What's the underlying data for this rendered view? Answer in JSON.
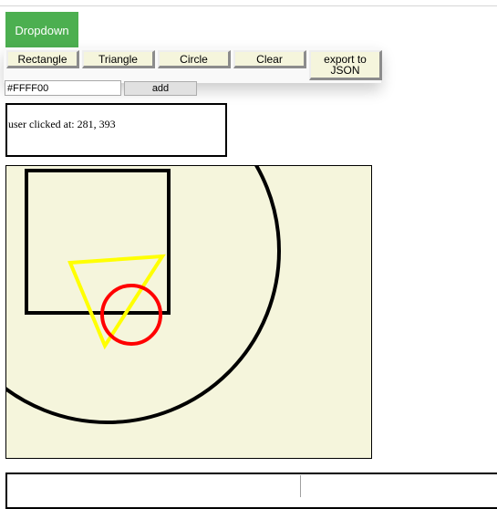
{
  "toolbar": {
    "dropdown_label": "Dropdown",
    "rectangle_label": "Rectangle",
    "triangle_label": "Triangle",
    "circle_label": "Circle",
    "clear_label": "Clear",
    "export_label": "export to JSON",
    "color_value": "#FFFF00",
    "add_label": "add"
  },
  "status": {
    "click_text": "user clicked at: 281, 393"
  },
  "canvas": {
    "background": "#F5F5DC",
    "shapes": [
      {
        "type": "circle",
        "stroke": "#000000"
      },
      {
        "type": "rectangle",
        "stroke": "#000000"
      },
      {
        "type": "triangle",
        "stroke": "#FFFF00"
      },
      {
        "type": "circle",
        "stroke": "#FF0000"
      }
    ]
  }
}
